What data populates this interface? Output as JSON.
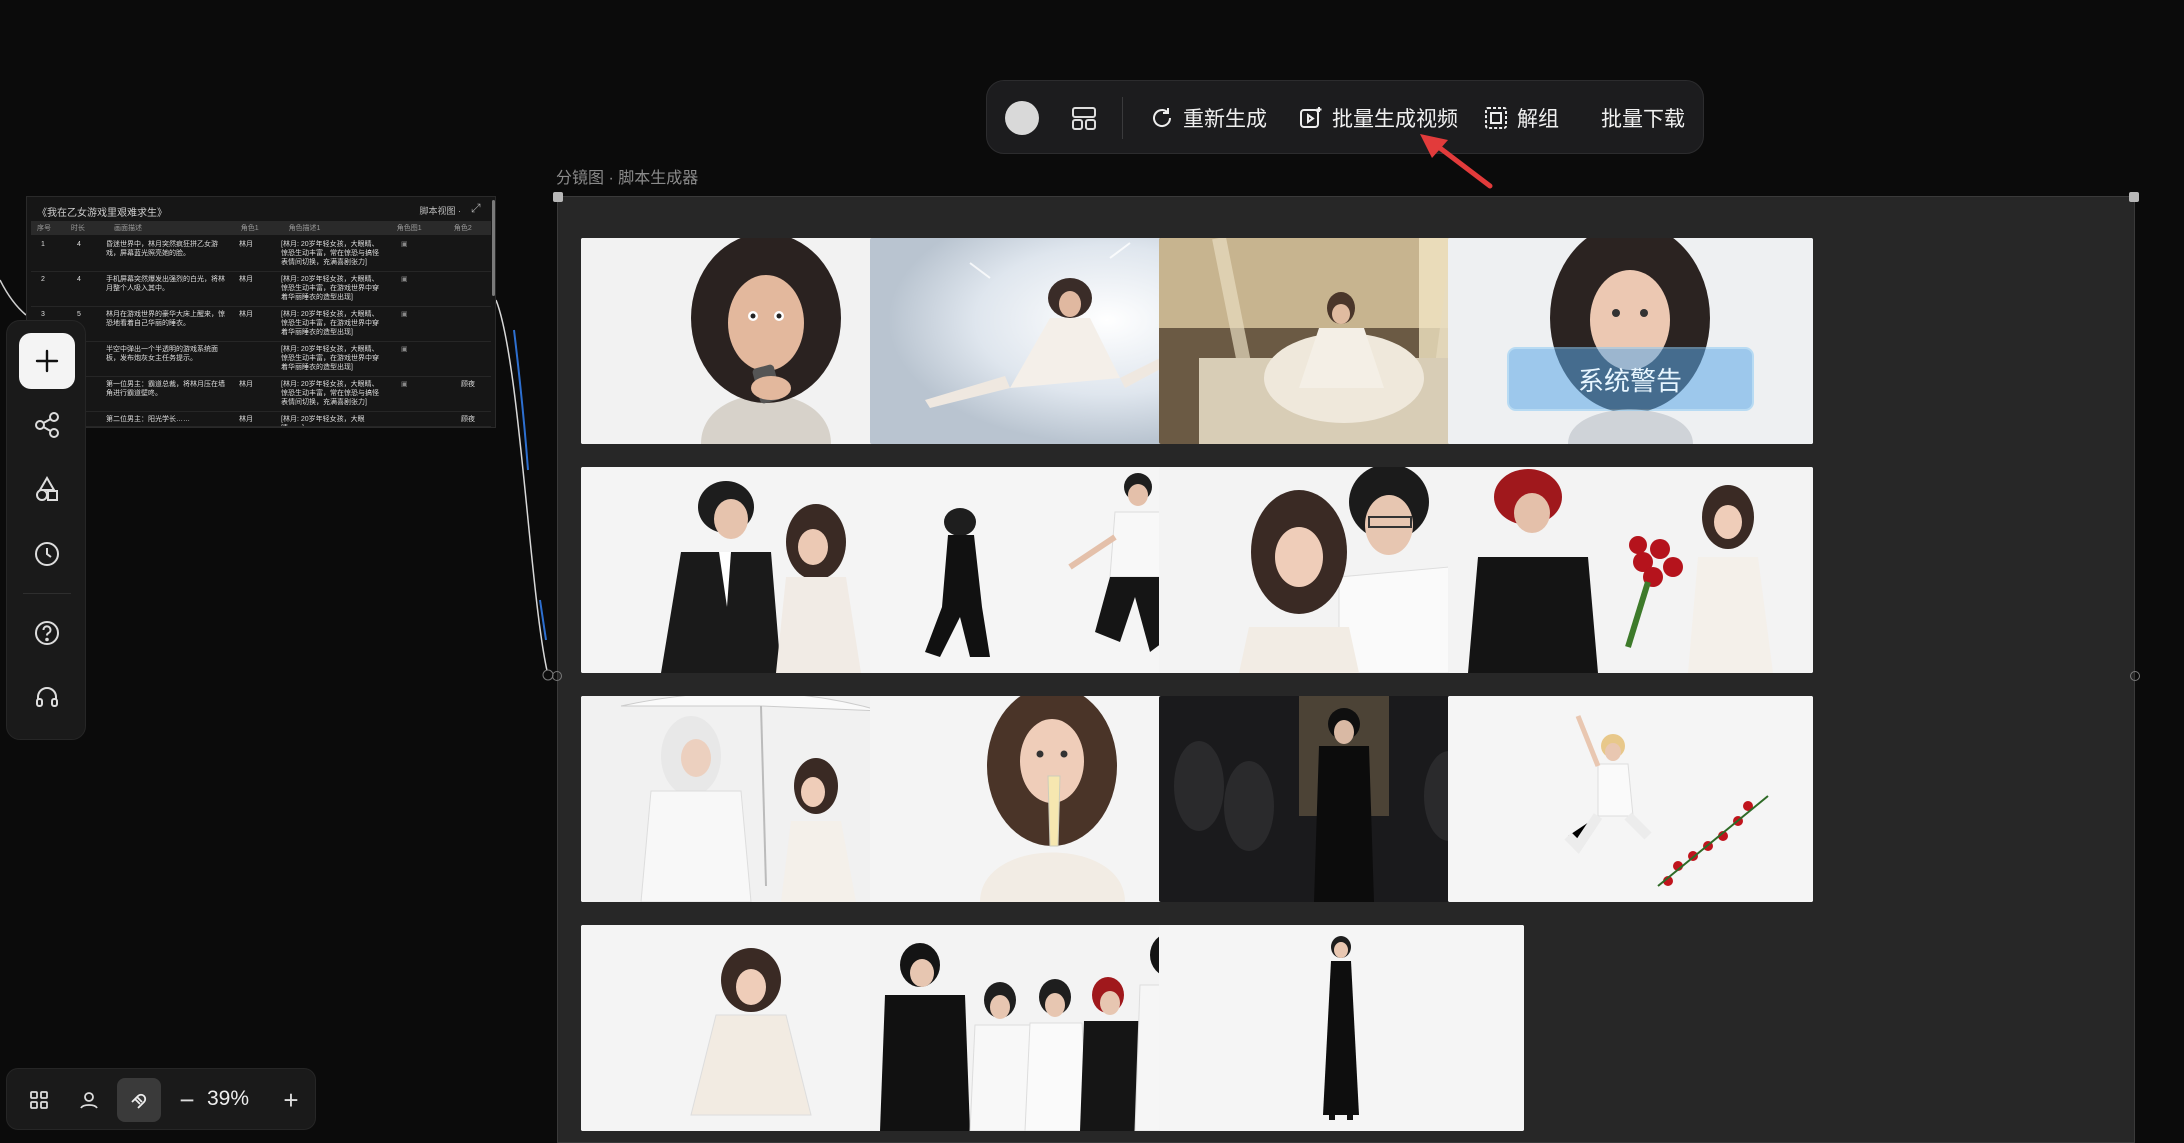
{
  "toolbar": {
    "regenerate_label": "重新生成",
    "batch_video_label": "批量生成视频",
    "ungroup_label": "解组",
    "batch_download_label": "批量下载",
    "color_swatch": "#d9d9d9"
  },
  "canvas": {
    "frame_label": "分镜图 · 脚本生成器"
  },
  "script_node": {
    "title": "《我在乙女游戏里艰难求生》",
    "view_label": "脚本视图 ·",
    "columns": [
      "序号",
      "时长",
      "画面描述",
      "角色1",
      "角色描述1",
      "角色图1",
      "角色2"
    ],
    "rows": [
      {
        "no": "1",
        "dur": "4",
        "desc": "昏迷世界中，林月突然疯狂拼乙女游戏，屏幕蓝光照亮她的脸。",
        "char": "林月",
        "char_desc": "[林月: 20岁年轻女孩，大眼睛、惊恐生动丰富，常在惊恐与搞怪表情间切换，充满喜剧张力]",
        "char2": ""
      },
      {
        "no": "2",
        "dur": "4",
        "desc": "手机屏幕突然爆发出强烈的白光，将林月整个人吸入其中。",
        "char": "林月",
        "char_desc": "[林月: 20岁年轻女孩，大眼睛、惊恐生动丰富，在游戏世界中穿着华丽睡衣的造型出现]",
        "char2": ""
      },
      {
        "no": "3",
        "dur": "5",
        "desc": "林月在游戏世界的豪华大床上醒来，惊恐地看着自己华丽的睡衣。",
        "char": "林月",
        "char_desc": "[林月: 20岁年轻女孩，大眼睛、惊恐生动丰富，在游戏世界中穿着华丽睡衣的造型出现]",
        "char2": ""
      },
      {
        "no": "4",
        "dur": "",
        "desc": "半空中弹出一个半透明的游戏系统面板，发布炮灰女主任务提示。",
        "char": "",
        "char_desc": "[林月: 20岁年轻女孩，大眼睛、惊恐生动丰富，在游戏世界中穿着华丽睡衣的造型出现]",
        "char2": ""
      },
      {
        "no": "5",
        "dur": "",
        "desc": "第一位男主：霸道总裁，将林月压在墙角进行霸道壁咚。",
        "char": "林月",
        "char_desc": "[林月: 20岁年轻女孩，大眼睛、惊恐生动丰富，常在惊恐与搞怪表情间切换，充满喜剧张力]",
        "char2": "顾夜"
      },
      {
        "no": "6",
        "dur": "",
        "desc": "第二位男主：阳光学长……",
        "char": "林月",
        "char_desc": "[林月: 20岁年轻女孩，大眼睛……]",
        "char2": "顾夜"
      }
    ]
  },
  "zoom": {
    "value": "39%",
    "minus": "−",
    "plus": "+"
  },
  "storyboard": {
    "frames": [
      {
        "scene": "girl-phone-shocked"
      },
      {
        "scene": "girl-sucked-into-light"
      },
      {
        "scene": "girl-luxury-bed"
      },
      {
        "scene": "system-warning-panel",
        "overlay_text": "系统警告"
      },
      {
        "scene": "ceo-wall-pin"
      },
      {
        "scene": "couple-running"
      },
      {
        "scene": "glasses-man-embrace"
      },
      {
        "scene": "redhair-roses"
      },
      {
        "scene": "white-umbrella-couple"
      },
      {
        "scene": "girl-champagne"
      },
      {
        "scene": "dark-ballroom"
      },
      {
        "scene": "jumping-boy-roses"
      },
      {
        "scene": "girl-crouching-distress"
      },
      {
        "scene": "five-men-group"
      },
      {
        "scene": "girl-black-dress"
      }
    ]
  }
}
